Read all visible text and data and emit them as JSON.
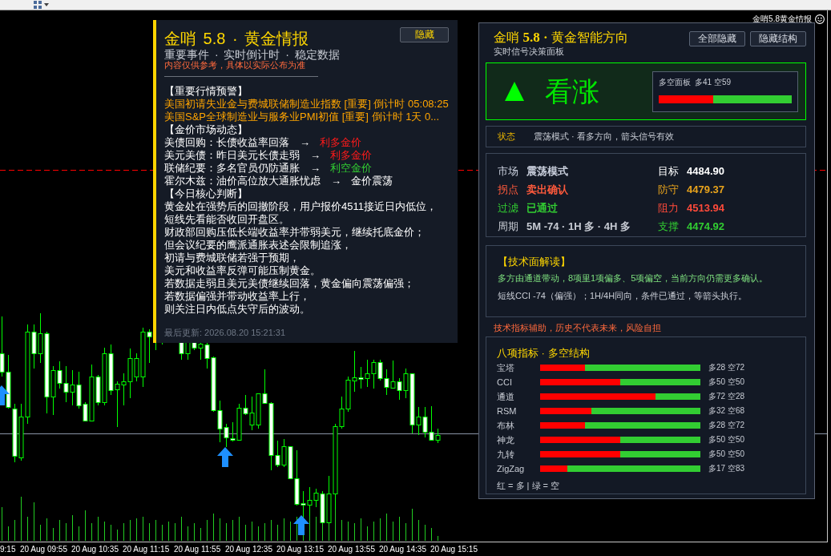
{
  "chart": {
    "indicator_label": "金哨5.8黄金情报",
    "time_axis": [
      "9:15",
      "20 Aug 09:55",
      "20 Aug 10:35",
      "20 Aug 11:15",
      "20 Aug 11:55",
      "20 Aug 12:35",
      "20 Aug 13:15",
      "20 Aug 13:55",
      "20 Aug 14:35",
      "20 Aug 15:15"
    ]
  },
  "news_panel": {
    "title": "金哨 5.8 · 黄金情报",
    "hide_button": "隐藏",
    "subtitle": "重要事件 · 实时倒计时 · 稳定数据",
    "notice": "内容仅供参考，具体以实际公布为准",
    "sections": [
      {
        "kind": "alerts",
        "heading": "【重要行情预警】",
        "lines": [
          "美国初请失业金与费城联储制造业指数 [重要] 倒计时 05:08:25",
          "美国S&P全球制造业与服务业PMI初值 [重要] 倒计时 1天 0..."
        ]
      },
      {
        "kind": "impacts",
        "heading": "【金价市场动态】",
        "items": [
          {
            "topic": "美债回购：长债收益率回落",
            "arrow": "→",
            "impact": "利多金价",
            "color": "#ff1a1a"
          },
          {
            "topic": "美元美债：昨日美元长债走弱",
            "arrow": "→",
            "impact": "利多金价",
            "color": "#ff1a1a"
          },
          {
            "topic": "联储纪要：多名官员仍防通胀",
            "arrow": "→",
            "impact": "利空金价",
            "color": "#32cd32"
          },
          {
            "topic": "霍尔木兹：油价高位放大通胀忧虑",
            "arrow": "→",
            "impact": "金价震荡",
            "color": "#ffffff"
          }
        ]
      },
      {
        "kind": "paragraph",
        "heading": "【今日核心判断】",
        "lines": [
          "黄金处在强势后的回撤阶段，用户报价4511接近日内低位，",
          "短线先看能否收回开盘区。",
          "财政部回购压低长端收益率并带弱美元，继续托底金价；",
          "但会议纪要的鹰派通胀表述会限制追涨，",
          "初请与费城联储若强于预期，",
          "美元和收益率反弹可能压制黄金。",
          "若数据走弱且美元美债继续回落，黄金偏向震荡偏强；",
          "若数据偏强并带动收益率上行，",
          "则关注日内低点失守后的波动。"
        ]
      }
    ],
    "updated": "最后更新: 2026.08.20 15:21:31"
  },
  "signal_panel": {
    "title": "金哨 **5.8 ·** 黄金智能方向",
    "subtitle": "实时信号决策面板",
    "buttons": [
      "全部隐藏",
      "隐藏结构"
    ],
    "signal": {
      "bullish": true,
      "label": "看涨",
      "balance": {
        "title": "多空面板",
        "reading": "多41 空59",
        "level": 0.41
      }
    },
    "status": {
      "label": "状态",
      "text": "震荡模式 · 看多方向，箭头信号有效"
    },
    "market": {
      "left": [
        {
          "label": "市场",
          "value": "震荡模式",
          "color": "#c8cedb"
        },
        {
          "label": "拐点",
          "value": "卖出确认",
          "color": "#ff5a3c"
        },
        {
          "label": "过滤",
          "value": "已通过",
          "color": "#32cd32"
        },
        {
          "label": "周期",
          "value": "5M -74 · 1H 多 · 4H 多",
          "color": "#c8ccd4"
        }
      ],
      "right": [
        {
          "label": "目标",
          "value": "4484.90",
          "color": "#ffffff"
        },
        {
          "label": "防守",
          "value": "4479.37",
          "color": "#e8a31c"
        },
        {
          "label": "阻力",
          "value": "4513.94",
          "color": "#ff4a3a"
        },
        {
          "label": "支撑",
          "value": "4474.92",
          "color": "#32cd32"
        }
      ]
    },
    "analysis": {
      "heading": "【技术面解读】",
      "lines": [
        {
          "text": "多方由通道带动，8项里1项偏多、5项偏空，当前方向仍需更多确认。",
          "color": "#7ee07e"
        },
        {
          "text": "短线CCI -74（偏强）；1H/4H同向，条件已通过，等箭头执行。",
          "color": "#c8ccd4"
        }
      ]
    },
    "disclaimer": "技术指标辅助，历史不代表未来，风险自担",
    "indicators": {
      "title": "八项指标 · 多空结构",
      "rows": [
        {
          "name": "宝塔",
          "level": 0.28,
          "reading": "多28 空72"
        },
        {
          "name": "CCI",
          "level": 0.5,
          "reading": "多50 空50"
        },
        {
          "name": "通道",
          "level": 0.72,
          "reading": "多72 空28"
        },
        {
          "name": "RSM",
          "level": 0.32,
          "reading": "多32 空68"
        },
        {
          "name": "布林",
          "level": 0.28,
          "reading": "多28 空72"
        },
        {
          "name": "神龙",
          "level": 0.5,
          "reading": "多50 空50"
        },
        {
          "name": "九转",
          "level": 0.5,
          "reading": "多50 空50"
        },
        {
          "name": "ZigZag",
          "level": 0.17,
          "reading": "多17 空83"
        }
      ],
      "legend": "红 = 多 | 绿 = 空"
    }
  }
}
